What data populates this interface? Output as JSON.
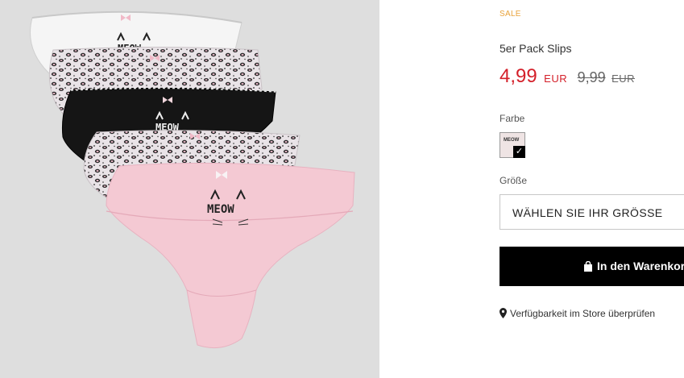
{
  "product": {
    "image_alt": "5er Pack Slips",
    "print_text": "MEOW",
    "badge": "SALE",
    "title": "5er Pack Slips",
    "price_current": "4,99",
    "price_current_currency": "EUR",
    "price_old": "9,99",
    "price_old_currency": "EUR"
  },
  "color": {
    "label": "Farbe",
    "swatch_name": "rosa-meow",
    "swatch_thumb_text": "MEOW",
    "selected_check": "✓"
  },
  "size": {
    "label": "Größe",
    "placeholder": "WÄHLEN SIE IHR GRÖSSE"
  },
  "cart": {
    "button_label": "In den Warenkorb"
  },
  "store": {
    "link_label": "Verfügbarkeit im Store überprüfen"
  },
  "colors": {
    "sale": "#e8a23a",
    "price": "#d4202a",
    "button": "#000000",
    "image_bg": "#dedede",
    "pink": "#f4c9d3"
  },
  "icons": {
    "bag": "shopping-bag-icon",
    "pin": "map-pin-icon",
    "check": "check-icon"
  }
}
